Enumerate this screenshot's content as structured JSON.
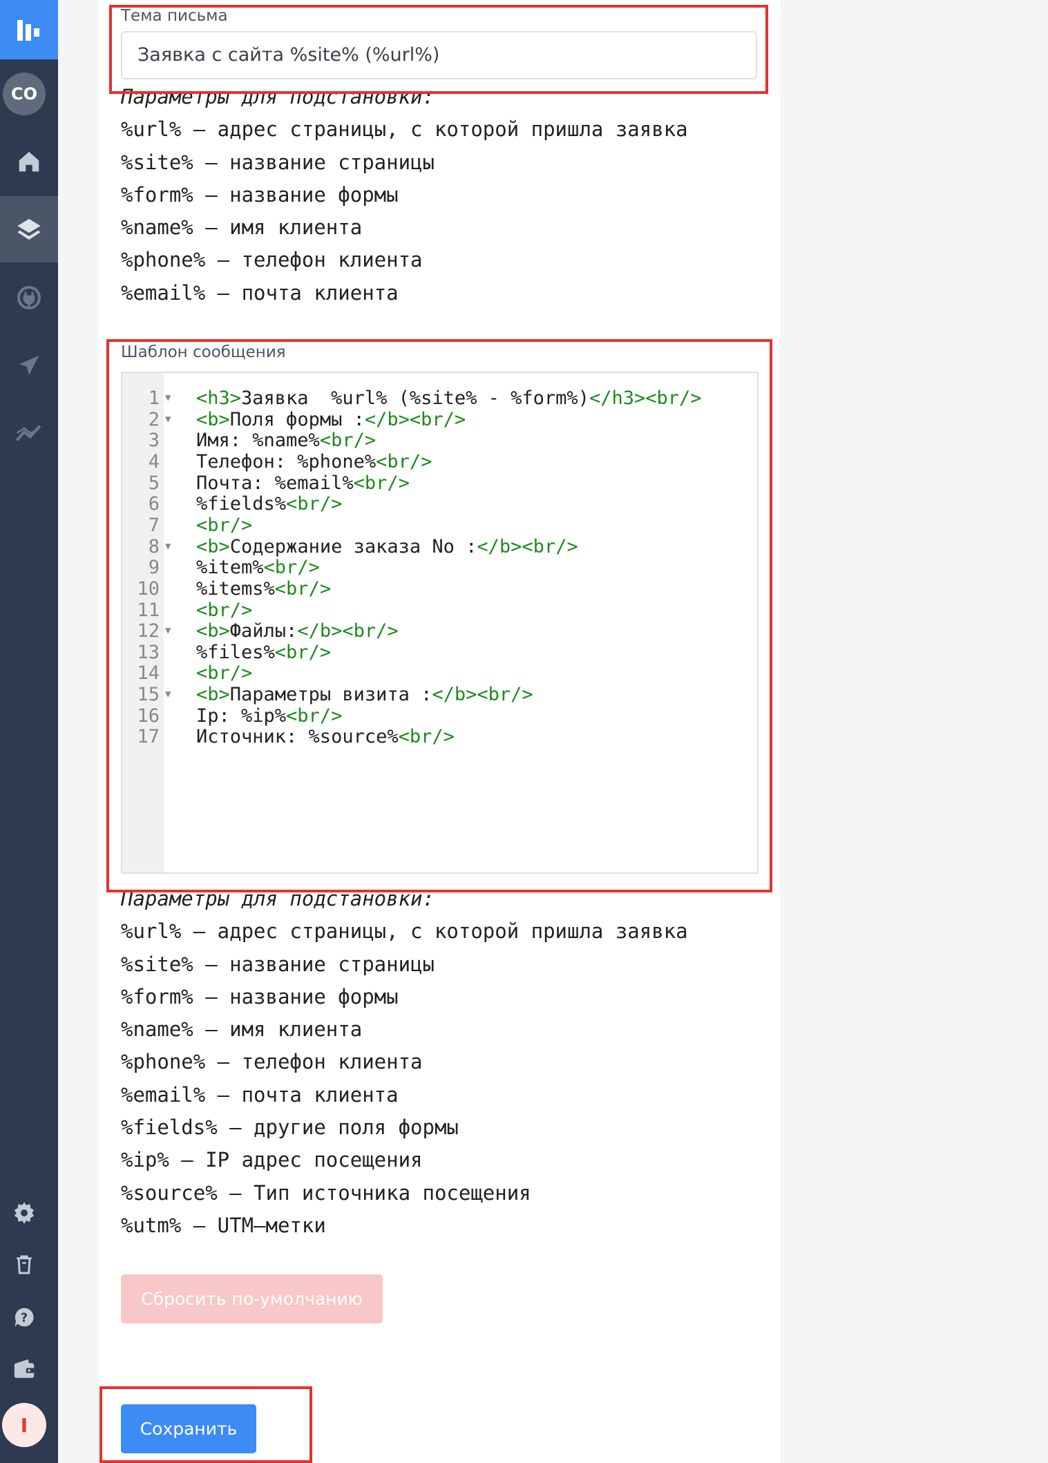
{
  "sidebar": {
    "logo_icon": "app-logo-icon",
    "workspace_initials": "CO",
    "items": [
      {
        "icon": "home-icon"
      },
      {
        "icon": "layers-icon",
        "active": true
      },
      {
        "icon": "plug-icon"
      },
      {
        "icon": "send-icon"
      },
      {
        "icon": "analytics-icon"
      }
    ],
    "bottom_items": [
      {
        "icon": "gear-icon"
      },
      {
        "icon": "trash-icon"
      },
      {
        "icon": "help-icon"
      },
      {
        "icon": "wallet-icon"
      }
    ],
    "user_initial": "I"
  },
  "subject": {
    "label": "Тема письма",
    "value": "Заявка с сайта %site% (%url%)"
  },
  "params_top": {
    "header": "Параметры для подстановки:",
    "lines": [
      "%url% – адрес страницы, с которой пришла заявка",
      "%site% – название страницы",
      "%form% – название формы",
      "%name% – имя клиента",
      "%phone% – телефон клиента",
      "%email% – почта клиента"
    ]
  },
  "template": {
    "label": "Шаблон сообщения",
    "lines": [
      {
        "n": "1",
        "fold": true,
        "parts": [
          [
            "t",
            "<h3>"
          ],
          [
            "x",
            "Заявка  %url% (%site% - %form%)"
          ],
          [
            "t",
            "</h3><br/>"
          ]
        ]
      },
      {
        "n": "2",
        "fold": true,
        "parts": [
          [
            "t",
            "<b>"
          ],
          [
            "x",
            "Поля формы :"
          ],
          [
            "t",
            "</b><br/>"
          ]
        ]
      },
      {
        "n": "3",
        "fold": false,
        "parts": [
          [
            "x",
            "Имя: %name%"
          ],
          [
            "t",
            "<br/>"
          ]
        ]
      },
      {
        "n": "4",
        "fold": false,
        "parts": [
          [
            "x",
            "Телефон: %phone%"
          ],
          [
            "t",
            "<br/>"
          ]
        ]
      },
      {
        "n": "5",
        "fold": false,
        "parts": [
          [
            "x",
            "Почта: %email%"
          ],
          [
            "t",
            "<br/>"
          ]
        ]
      },
      {
        "n": "6",
        "fold": false,
        "parts": [
          [
            "x",
            "%fields%"
          ],
          [
            "t",
            "<br/>"
          ]
        ]
      },
      {
        "n": "7",
        "fold": false,
        "parts": [
          [
            "t",
            "<br/>"
          ]
        ]
      },
      {
        "n": "8",
        "fold": true,
        "parts": [
          [
            "t",
            "<b>"
          ],
          [
            "x",
            "Содержание заказа No :"
          ],
          [
            "t",
            "</b><br/>"
          ]
        ]
      },
      {
        "n": "9",
        "fold": false,
        "parts": [
          [
            "x",
            "%item%"
          ],
          [
            "t",
            "<br/>"
          ]
        ]
      },
      {
        "n": "10",
        "fold": false,
        "parts": [
          [
            "x",
            "%items%"
          ],
          [
            "t",
            "<br/>"
          ]
        ]
      },
      {
        "n": "11",
        "fold": false,
        "parts": [
          [
            "t",
            "<br/>"
          ]
        ]
      },
      {
        "n": "12",
        "fold": true,
        "parts": [
          [
            "t",
            "<b>"
          ],
          [
            "x",
            "Файлы:"
          ],
          [
            "t",
            "</b><br/>"
          ]
        ]
      },
      {
        "n": "13",
        "fold": false,
        "parts": [
          [
            "x",
            "%files%"
          ],
          [
            "t",
            "<br/>"
          ]
        ]
      },
      {
        "n": "14",
        "fold": false,
        "parts": [
          [
            "t",
            "<br/>"
          ]
        ]
      },
      {
        "n": "15",
        "fold": true,
        "parts": [
          [
            "t",
            "<b>"
          ],
          [
            "x",
            "Параметры визита :"
          ],
          [
            "t",
            "</b><br/>"
          ]
        ]
      },
      {
        "n": "16",
        "fold": false,
        "parts": [
          [
            "x",
            "Ip: %ip%"
          ],
          [
            "t",
            "<br/>"
          ]
        ]
      },
      {
        "n": "17",
        "fold": false,
        "parts": [
          [
            "x",
            "Источник: %source%"
          ],
          [
            "t",
            "<br/>"
          ]
        ]
      }
    ]
  },
  "params_bottom": {
    "header": "Параметры для подстановки:",
    "lines": [
      "%url% – адрес страницы, с которой пришла заявка",
      "%site% – название страницы",
      "%form% – название формы",
      "%name% – имя клиента",
      "%phone% – телефон клиента",
      "%email% – почта клиента",
      "%fields% – другие поля формы",
      "%ip% – IP адрес посещения",
      "%source% – Тип источника посещения",
      "%utm% – UTM–метки"
    ]
  },
  "buttons": {
    "reset_label": "Сбросить по-умолчанию",
    "save_label": "Сохранить"
  },
  "colors": {
    "sidebar_bg": "#2d3a4f",
    "accent_blue": "#3d8bf5",
    "highlight_red": "#e4322b",
    "code_tag_green": "#1d8a1d"
  }
}
